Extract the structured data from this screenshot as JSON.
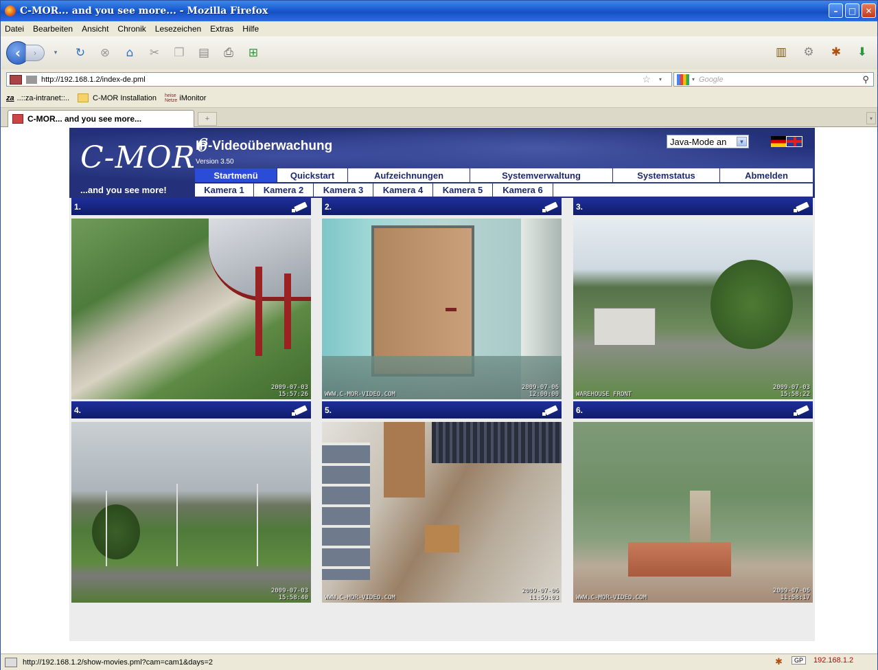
{
  "window": {
    "title": "C-MOR... and you see more... - Mozilla Firefox"
  },
  "menu": [
    "Datei",
    "Bearbeiten",
    "Ansicht",
    "Chronik",
    "Lesezeichen",
    "Extras",
    "Hilfe"
  ],
  "address": {
    "url": "http://192.168.1.2/index-de.pml",
    "search_placeholder": "Google"
  },
  "bookmarks": [
    {
      "label": "..::za-intranet::..",
      "icon": "za-icon"
    },
    {
      "label": "C-MOR Installation",
      "icon": "folder-icon"
    },
    {
      "label": "iMonitor",
      "icon": "heise-icon"
    }
  ],
  "tab": {
    "label": "C-MOR... and you see more..."
  },
  "header": {
    "logo": "C-MOR",
    "logo_superscript": "6",
    "tagline": "...and you see more!",
    "title": "IP-Videoüberwachung",
    "version": "Version 3.50",
    "java_mode": "Java-Mode an"
  },
  "nav": [
    "Startmenü",
    "Quickstart",
    "Aufzeichnungen",
    "Systemverwaltung",
    "Systemstatus",
    "Abmelden"
  ],
  "subnav": [
    "Kamera 1",
    "Kamera 2",
    "Kamera 3",
    "Kamera 4",
    "Kamera 5",
    "Kamera 6"
  ],
  "cameras": [
    {
      "label": "1.",
      "date": "2009-07-03",
      "time": "15:57:26",
      "watermark": ""
    },
    {
      "label": "2.",
      "date": "2009-07-06",
      "time": "12:00:00",
      "watermark": "WWW.C-MOR-VIDEO.COM"
    },
    {
      "label": "3.",
      "date": "2009-07-03",
      "time": "15:58:22",
      "watermark": "WAREHOUSE FRONT"
    },
    {
      "label": "4.",
      "date": "2009-07-03",
      "time": "15:58:40",
      "watermark": ""
    },
    {
      "label": "5.",
      "date": "2009-07-06",
      "time": "11:59:03",
      "watermark": "WWW.C-MOR-VIDEO.COM"
    },
    {
      "label": "6.",
      "date": "2009-07-06",
      "time": "11:58:17",
      "watermark": "WWW.C-MOR-VIDEO.COM"
    }
  ],
  "status": {
    "url": "http://192.168.1.2/show-movies.pml?cam=cam1&days=2",
    "gp": "GP",
    "ip": "192.168.1.2"
  },
  "colors": {
    "title_bar": "#1a5bd0",
    "header_bg": "#202d6e",
    "nav_active": "#2a4cd6",
    "status_ip": "#c00000"
  }
}
